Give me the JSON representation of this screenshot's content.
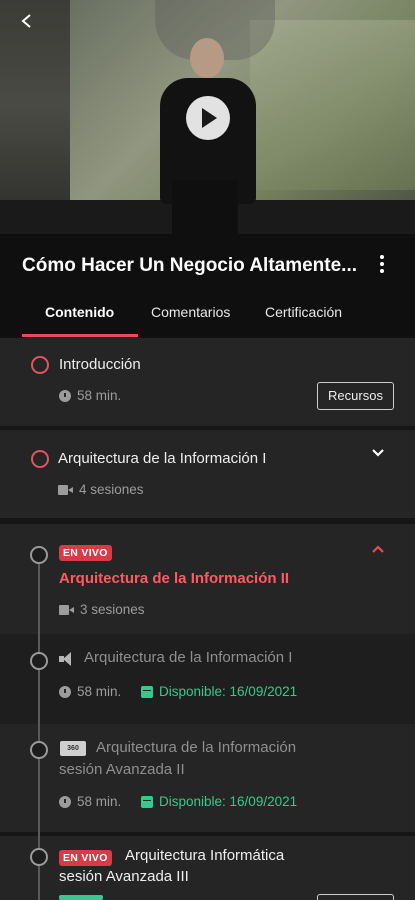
{
  "header": {
    "course_title": "Cómo Hacer Un Negocio Altamente...",
    "tabs": [
      {
        "label": "Contenido",
        "active": true
      },
      {
        "label": "Comentarios",
        "active": false
      },
      {
        "label": "Certificación",
        "active": false
      }
    ]
  },
  "modules": [
    {
      "title": "Introducción",
      "duration": "58 min.",
      "action": "Recursos"
    },
    {
      "title": "Arquitectura de la Información I",
      "sessions": "4 sesiones",
      "expanded": false
    },
    {
      "badge": "EN VIVO",
      "title": "Arquitectura de la Información II",
      "sessions": "3 sesiones",
      "expanded": true
    }
  ],
  "lessons": [
    {
      "title": "Arquitectura de la Información I",
      "duration": "58 min.",
      "availability": "Disponible: 16/09/2021"
    },
    {
      "title_line1": "Arquitectura de la Información",
      "title_line2": "sesión Avanzada II",
      "duration": "58 min.",
      "availability": "Disponible: 16/09/2021"
    },
    {
      "badge": "EN VIVO",
      "title_line1": "Arquitectura Informática",
      "title_line2": "sesión Avanzada III"
    }
  ],
  "colors": {
    "accent": "#e84a57",
    "live": "#d63b47",
    "available": "#36c98e"
  },
  "icons": {
    "back": "arrow-left-icon",
    "play": "play-icon",
    "more": "more-vertical-icon"
  }
}
